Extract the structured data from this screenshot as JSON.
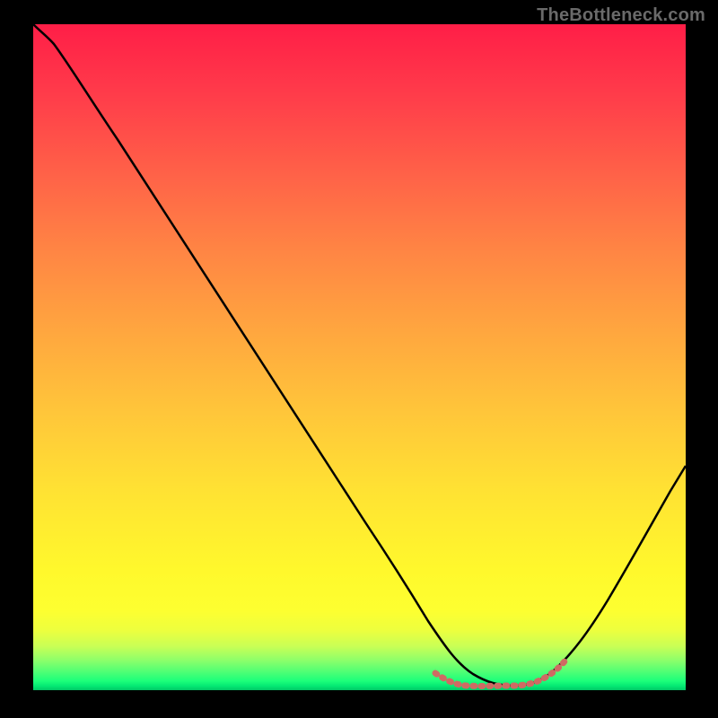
{
  "watermark": "TheBottleneck.com",
  "chart_data": {
    "type": "line",
    "title": "",
    "xlabel": "",
    "ylabel": "",
    "xlim": [
      0,
      100
    ],
    "ylim": [
      0,
      100
    ],
    "grid": false,
    "legend": false,
    "series": [
      {
        "name": "main-curve",
        "color": "#000000",
        "x": [
          0,
          3,
          10,
          20,
          30,
          40,
          50,
          57,
          60,
          63,
          66,
          70,
          74,
          76,
          80,
          85,
          90,
          95,
          100
        ],
        "y": [
          100,
          98,
          89,
          75,
          61,
          47,
          33,
          22,
          15,
          9,
          5,
          2,
          1,
          1,
          4,
          12,
          22,
          32,
          43
        ]
      },
      {
        "name": "highlight-segment",
        "color": "#cf6a63",
        "x": [
          60,
          62,
          64,
          66,
          68,
          70,
          72,
          74,
          76,
          78
        ],
        "y": [
          2,
          1.5,
          1.2,
          1,
          0.9,
          0.9,
          1,
          1.4,
          1.8,
          2.4
        ]
      }
    ],
    "background_gradient": {
      "top": "#ff1e47",
      "mid": "#ffe233",
      "bottom": "#02c765"
    }
  }
}
